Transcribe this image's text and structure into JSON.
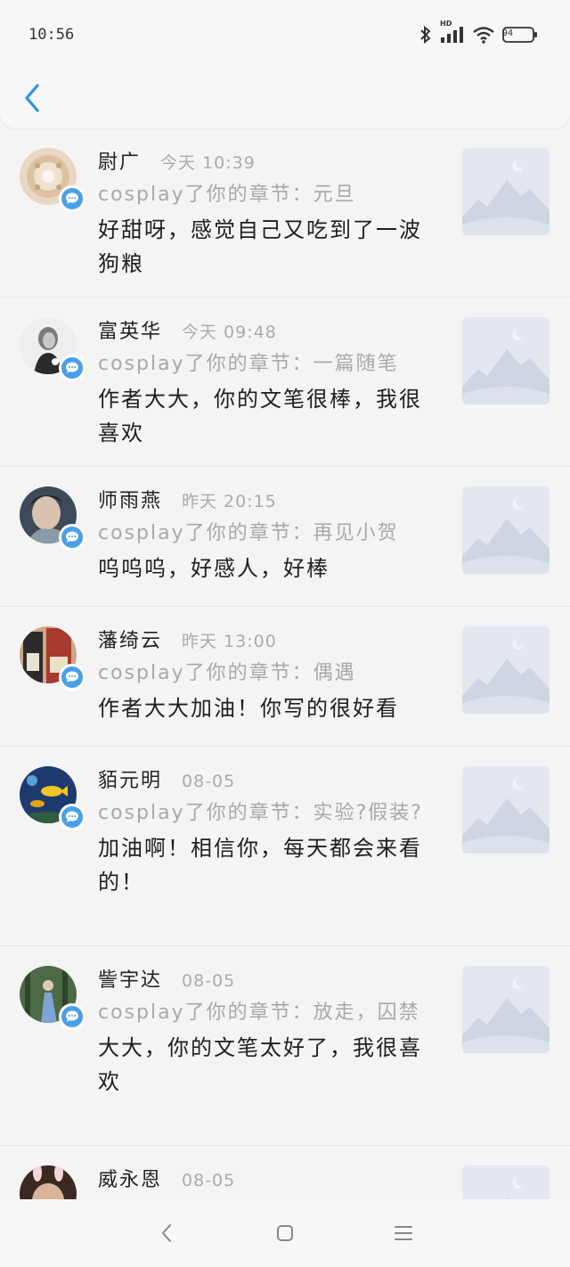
{
  "status_bar": {
    "time": "10:56",
    "hd_label": "HD",
    "battery": "94"
  },
  "header": {
    "back_icon": "chevron-left-icon",
    "accent": "#2f8fe6"
  },
  "comments": [
    {
      "name": "尉广",
      "time": "今天 10:39",
      "ref": "cosplay了你的章节：元旦",
      "message": "好甜呀，感觉自己又吃到了一波狗粮"
    },
    {
      "name": "富英华",
      "time": "今天 09:48",
      "ref": "cosplay了你的章节：一篇随笔",
      "message": "作者大大，你的文笔很棒，我很喜欢"
    },
    {
      "name": "师雨燕",
      "time": "昨天 20:15",
      "ref": "cosplay了你的章节：再见小贺",
      "message": "呜呜呜，好感人，好棒"
    },
    {
      "name": "藩绮云",
      "time": "昨天 13:00",
      "ref": "cosplay了你的章节：偶遇",
      "message": "作者大大加油！你写的很好看"
    },
    {
      "name": "貊元明",
      "time": "08-05",
      "ref": "cosplay了你的章节：实验?假装?",
      "message": "加油啊！相信你，每天都会来看的！"
    },
    {
      "name": "訾宇达",
      "time": "08-05",
      "ref": "cosplay了你的章节：放走，囚禁",
      "message": "大大，你的文笔太好了，我很喜欢"
    },
    {
      "name": "威永恩",
      "time": "08-05",
      "ref": "",
      "message": ""
    }
  ],
  "colors": {
    "badge": "#4a9fe8",
    "secondary_text": "#a8a8a8"
  }
}
